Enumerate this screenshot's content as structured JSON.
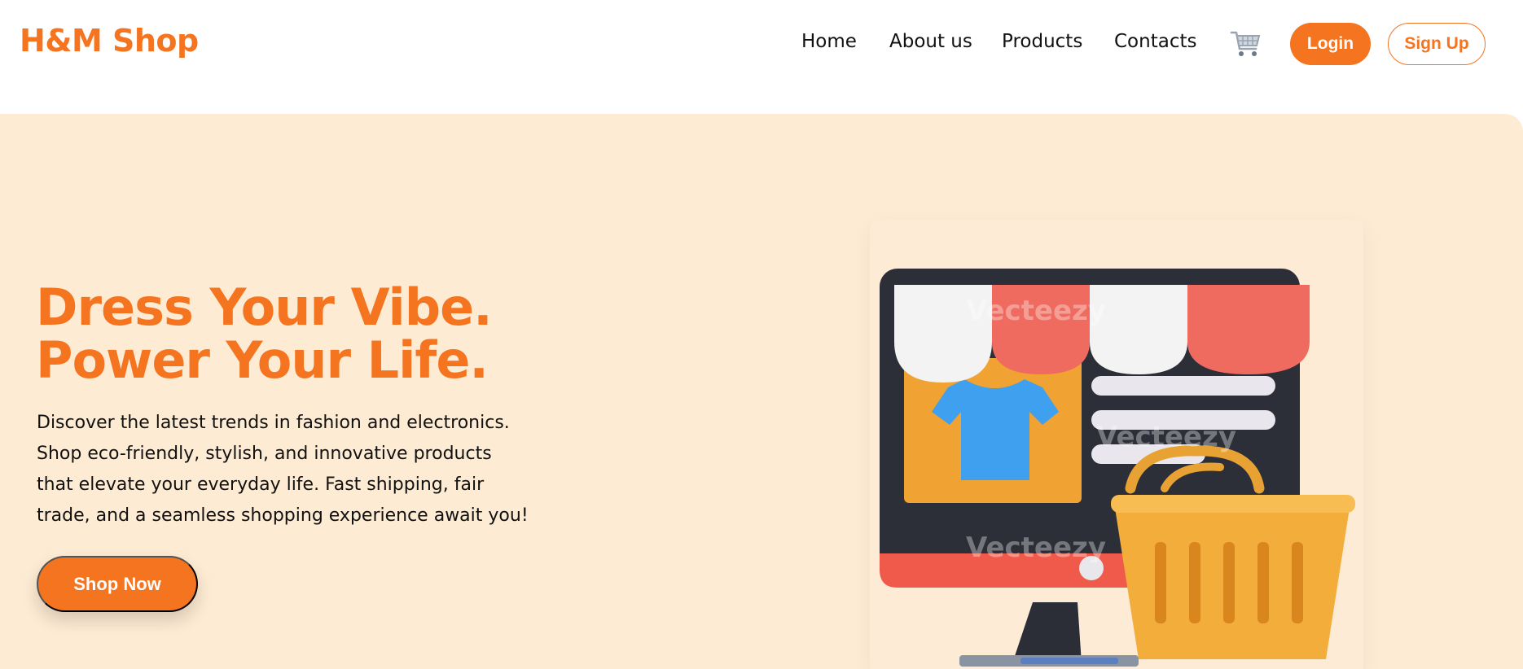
{
  "header": {
    "logo": "H&M Shop",
    "nav": [
      "Home",
      "About us",
      "Products",
      "Contacts"
    ],
    "cart_icon": "shopping-cart-icon",
    "login_label": "Login",
    "signup_label": "Sign Up"
  },
  "hero": {
    "headline_line1": "Dress Your Vibe.",
    "headline_line2": "Power Your Life.",
    "description": "Discover the latest trends in fashion and electronics. Shop eco-friendly, stylish, and innovative products that elevate your everyday life. Fast shipping, fair trade, and a seamless shopping experience await you!",
    "cta_label": "Shop Now",
    "illustration": "online-store-illustration",
    "watermark": "Vecteezy"
  },
  "colors": {
    "accent": "#f47420",
    "hero_bg": "#feebd3"
  }
}
